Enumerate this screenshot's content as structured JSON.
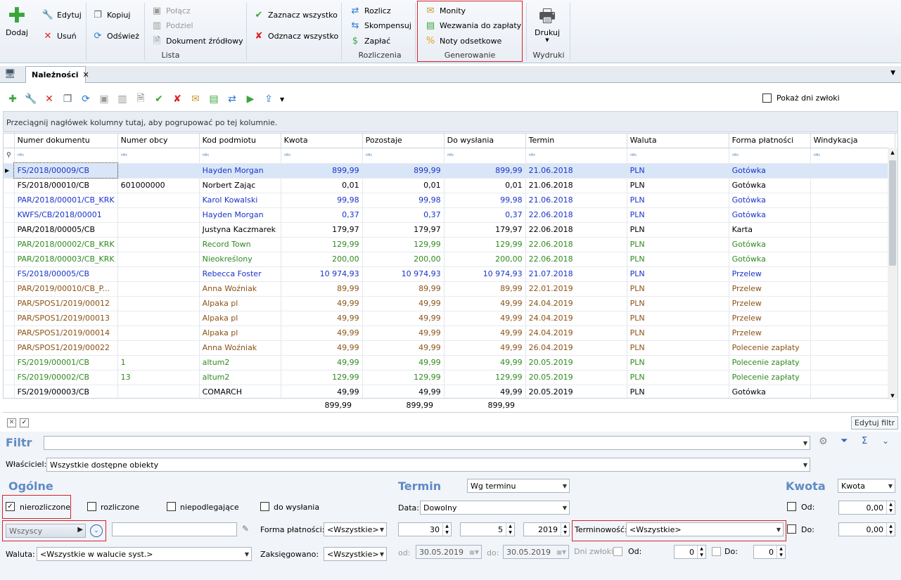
{
  "ribbon": {
    "dodaj": "Dodaj",
    "edytuj": "Edytuj",
    "usun": "Usuń",
    "kopiuj": "Kopiuj",
    "odswiez": "Odśwież",
    "polacz": "Połącz",
    "podziel": "Podziel",
    "dokument": "Dokument źródłowy",
    "zaznacz": "Zaznacz wszystko",
    "odznacz": "Odznacz wszystko",
    "lista": "Lista",
    "rozlicz": "Rozlicz",
    "skompensuj": "Skompensuj",
    "zaplac": "Zapłać",
    "rozliczenia": "Rozliczenia",
    "monity": "Monity",
    "wezwania": "Wezwania do zapłaty",
    "noty": "Noty odsetkowe",
    "generowanie": "Generowanie",
    "drukuj": "Drukuj",
    "wydruki": "Wydruki"
  },
  "tab": {
    "label": "Należności"
  },
  "toolbar": {
    "pokaz_dni": "Pokaż dni zwłoki"
  },
  "group_hint": "Przeciągnij nagłówek kolumny tutaj, aby pogrupować po tej kolumnie.",
  "columns": [
    "Numer dokumentu",
    "Numer obcy",
    "Kod podmiotu",
    "Kwota",
    "Pozostaje",
    "Do wysłania",
    "Termin",
    "Waluta",
    "Forma płatności",
    "Windykacja"
  ],
  "rows": [
    {
      "c": "blue",
      "sel": true,
      "v": [
        "FS/2018/00009/CB",
        "",
        "Hayden Morgan",
        "899,99",
        "899,99",
        "899,99",
        "21.06.2018",
        "PLN",
        "Gotówka",
        ""
      ]
    },
    {
      "c": "black",
      "v": [
        "FS/2018/00010/CB",
        "601000000",
        "Norbert Zając",
        "0,01",
        "0,01",
        "0,01",
        "21.06.2018",
        "PLN",
        "Gotówka",
        ""
      ]
    },
    {
      "c": "blue",
      "v": [
        "PAR/2018/00001/CB_KRK",
        "",
        "Karol Kowalski",
        "99,98",
        "99,98",
        "99,98",
        "21.06.2018",
        "PLN",
        "Gotówka",
        ""
      ]
    },
    {
      "c": "blue",
      "v": [
        "KWFS/CB/2018/00001",
        "",
        "Hayden Morgan",
        "0,37",
        "0,37",
        "0,37",
        "22.06.2018",
        "PLN",
        "Gotówka",
        ""
      ]
    },
    {
      "c": "black",
      "v": [
        "PAR/2018/00005/CB",
        "",
        "Justyna Kaczmarek",
        "179,97",
        "179,97",
        "179,97",
        "22.06.2018",
        "PLN",
        "Karta",
        ""
      ]
    },
    {
      "c": "green",
      "v": [
        "PAR/2018/00002/CB_KRK",
        "",
        "Record Town",
        "129,99",
        "129,99",
        "129,99",
        "22.06.2018",
        "PLN",
        "Gotówka",
        ""
      ]
    },
    {
      "c": "green",
      "v": [
        "PAR/2018/00003/CB_KRK",
        "",
        "Nieokreślony",
        "200,00",
        "200,00",
        "200,00",
        "22.06.2018",
        "PLN",
        "Gotówka",
        ""
      ]
    },
    {
      "c": "blue",
      "v": [
        "FS/2018/00005/CB",
        "",
        "Rebecca Foster",
        "10 974,93",
        "10 974,93",
        "10 974,93",
        "21.07.2018",
        "PLN",
        "Przelew",
        ""
      ]
    },
    {
      "c": "brown",
      "v": [
        "PAR/2019/00010/CB_P...",
        "",
        "Anna Woźniak",
        "89,99",
        "89,99",
        "89,99",
        "22.01.2019",
        "PLN",
        "Przelew",
        ""
      ]
    },
    {
      "c": "brown",
      "v": [
        "PAR/SPOS1/2019/00012",
        "",
        "Alpaka pl",
        "49,99",
        "49,99",
        "49,99",
        "24.04.2019",
        "PLN",
        "Przelew",
        ""
      ]
    },
    {
      "c": "brown",
      "v": [
        "PAR/SPOS1/2019/00013",
        "",
        "Alpaka pl",
        "49,99",
        "49,99",
        "49,99",
        "24.04.2019",
        "PLN",
        "Przelew",
        ""
      ]
    },
    {
      "c": "brown",
      "v": [
        "PAR/SPOS1/2019/00014",
        "",
        "Alpaka pl",
        "49,99",
        "49,99",
        "49,99",
        "24.04.2019",
        "PLN",
        "Przelew",
        ""
      ]
    },
    {
      "c": "brown",
      "v": [
        "PAR/SPOS1/2019/00022",
        "",
        "Anna Woźniak",
        "49,99",
        "49,99",
        "49,99",
        "26.04.2019",
        "PLN",
        "Polecenie zapłaty",
        ""
      ]
    },
    {
      "c": "green",
      "v": [
        "FS/2019/00001/CB",
        "1",
        "altum2",
        "49,99",
        "49,99",
        "49,99",
        "20.05.2019",
        "PLN",
        "Polecenie zapłaty",
        ""
      ]
    },
    {
      "c": "green",
      "v": [
        "FS/2019/00002/CB",
        "13",
        "altum2",
        "129,99",
        "129,99",
        "129,99",
        "20.05.2019",
        "PLN",
        "Polecenie zapłaty",
        ""
      ]
    },
    {
      "c": "black",
      "v": [
        "FS/2019/00003/CB",
        "",
        "COMARCH",
        "49,99",
        "49,99",
        "49,99",
        "20.05.2019",
        "PLN",
        "Gotówka",
        ""
      ]
    }
  ],
  "sums": {
    "kwota": "899,99",
    "pozostaje": "899,99",
    "do_wyslania": "899,99"
  },
  "edytuj_filtr": "Edytuj filtr",
  "filter": {
    "filtr": "Filtr",
    "wlasciciel_label": "Właściciel:",
    "wlasciciel_value": "Wszystkie dostępne obiekty",
    "ogolne": "Ogólne",
    "nierozliczone": "nierozliczone",
    "rozliczone": "rozliczone",
    "niepodlegajace": "niepodlegające",
    "do_wyslania": "do wysłania",
    "wszyscy": "Wszyscy",
    "forma_label": "Forma płatności:",
    "forma_value": "<Wszystkie>",
    "waluta_label": "Waluta:",
    "waluta_value": "<Wszystkie w walucie syst.>",
    "zaksiegowano_label": "Zaksięgowano:",
    "zaksiegowano_value": "<Wszystkie>",
    "termin": "Termin",
    "termin_value": "Wg terminu",
    "data_label": "Data:",
    "data_value": "Dowolny",
    "day": "30",
    "month": "5",
    "year": "2019",
    "terminowosc_label": "Terminowość:",
    "terminowosc_value": "<Wszystkie>",
    "od_label": "od:",
    "od_date": "30.05.2019",
    "do_label": "do:",
    "do_date": "30.05.2019",
    "dni_zwloki": "Dni zwłoki:",
    "dni_od": "Od:",
    "dni_od_v": "0",
    "dni_do": "Do:",
    "dni_do_v": "0",
    "kwota": "Kwota",
    "kwota_value": "Kwota",
    "kwota_od": "Od:",
    "kwota_od_v": "0,00",
    "kwota_do": "Do:",
    "kwota_do_v": "0,00"
  }
}
